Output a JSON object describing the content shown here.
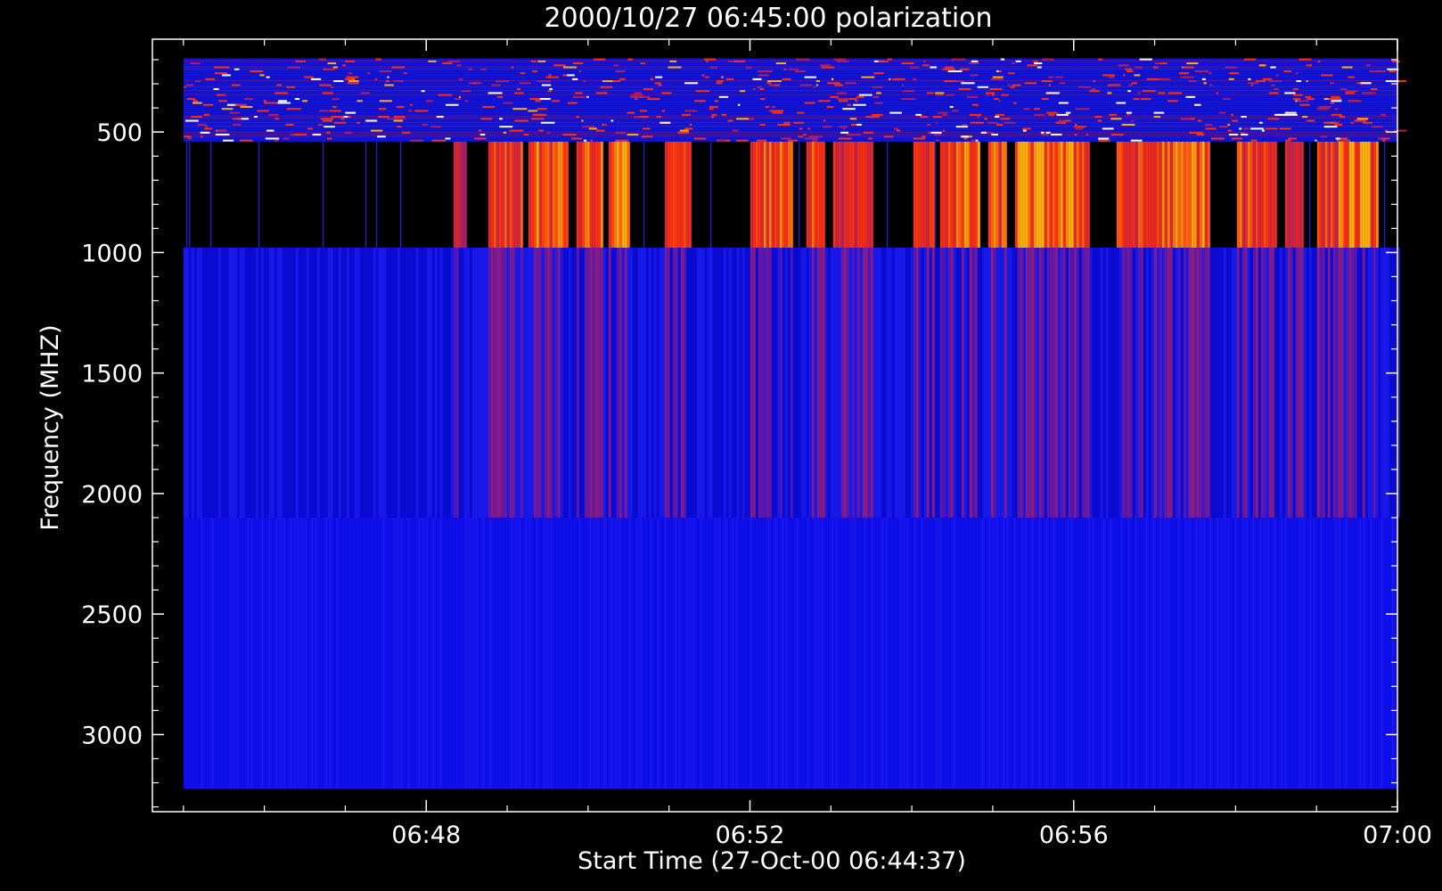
{
  "chart_data": {
    "type": "heatmap",
    "title": "2000/10/27 06:45:00 polarization",
    "xlabel": "Start Time (27-Oct-00 06:44:37)",
    "ylabel": "Frequency (MHZ)",
    "x_range": [
      "06:44:37",
      "07:00:00"
    ],
    "y_range": [
      3320,
      115
    ],
    "x_ticks": [
      {
        "time": "06:48",
        "label": "06:48"
      },
      {
        "time": "06:52",
        "label": "06:52"
      },
      {
        "time": "06:56",
        "label": "06:56"
      },
      {
        "time": "07:00",
        "label": "07:00"
      }
    ],
    "y_ticks": [
      {
        "value": 500,
        "label": "500"
      },
      {
        "value": 1000,
        "label": "1000"
      },
      {
        "value": 1500,
        "label": "1500"
      },
      {
        "value": 2000,
        "label": "2000"
      },
      {
        "value": 2500,
        "label": "2500"
      },
      {
        "value": 3000,
        "label": "3000"
      }
    ],
    "data_time_range": [
      "06:45:00",
      "07:00:00"
    ],
    "bands": [
      {
        "name": "band-200-540",
        "f_low": 540,
        "f_high": 195,
        "style": "noisy"
      },
      {
        "name": "band-540-980",
        "f_low": 980,
        "f_high": 540,
        "style": "bursts"
      },
      {
        "name": "band-980-2100",
        "f_low": 2100,
        "f_high": 980,
        "style": "striped"
      },
      {
        "name": "band-2100-3225",
        "f_low": 3225,
        "f_high": 2100,
        "style": "uniform"
      }
    ],
    "colors": {
      "background": "#000000",
      "low": "#1010ee",
      "mid": "#b02060",
      "high": "#ff3010",
      "peak": "#ffb010"
    },
    "bursts": [
      {
        "start": "06:48:20",
        "end": "06:48:30",
        "level": 0.55
      },
      {
        "start": "06:48:45",
        "end": "06:49:10",
        "level": 0.75
      },
      {
        "start": "06:49:15",
        "end": "06:49:45",
        "level": 0.9
      },
      {
        "start": "06:49:50",
        "end": "06:50:10",
        "level": 0.85
      },
      {
        "start": "06:50:15",
        "end": "06:50:30",
        "level": 1.0
      },
      {
        "start": "06:50:55",
        "end": "06:51:15",
        "level": 0.7
      },
      {
        "start": "06:52:00",
        "end": "06:52:30",
        "level": 0.85
      },
      {
        "start": "06:52:40",
        "end": "06:52:55",
        "level": 0.95
      },
      {
        "start": "06:53:00",
        "end": "06:53:30",
        "level": 0.65
      },
      {
        "start": "06:54:00",
        "end": "06:54:15",
        "level": 0.7
      },
      {
        "start": "06:54:20",
        "end": "06:54:50",
        "level": 0.9
      },
      {
        "start": "06:54:55",
        "end": "06:55:10",
        "level": 0.85
      },
      {
        "start": "06:55:15",
        "end": "06:55:45",
        "level": 1.0
      },
      {
        "start": "06:55:45",
        "end": "06:56:10",
        "level": 0.95
      },
      {
        "start": "06:56:30",
        "end": "06:57:00",
        "level": 0.75
      },
      {
        "start": "06:57:00",
        "end": "06:57:25",
        "level": 0.9
      },
      {
        "start": "06:57:25",
        "end": "06:57:40",
        "level": 1.0
      },
      {
        "start": "06:58:00",
        "end": "06:58:30",
        "level": 0.8
      },
      {
        "start": "06:58:35",
        "end": "06:58:50",
        "level": 0.6
      },
      {
        "start": "06:59:00",
        "end": "06:59:15",
        "level": 0.75
      },
      {
        "start": "06:59:15",
        "end": "06:59:45",
        "level": 1.0
      }
    ]
  }
}
